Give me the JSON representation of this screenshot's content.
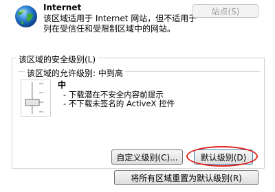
{
  "zone": {
    "title": "Internet",
    "description": "该区域适用于 Internet 网站，但不适用于列在受信任和受限制区域中的网站。",
    "sites_button": "站点(S)"
  },
  "security": {
    "group_title": "该区域的安全级别(L)",
    "allowed_levels_label": "该区域的允许级别: 中到高",
    "level_name": "中",
    "bullets": [
      "下载潜在不安全内容前提示",
      "不下载未签名的 ActiveX 控件"
    ],
    "custom_button": "自定义级别(C)...",
    "default_button": "默认级别(D)"
  },
  "reset_button": "将所有区域重置为默认级别(R)",
  "colors": {
    "highlight_oval": "#e0201b",
    "globe_blue": "#1e6fc4",
    "globe_green": "#3aa541"
  }
}
